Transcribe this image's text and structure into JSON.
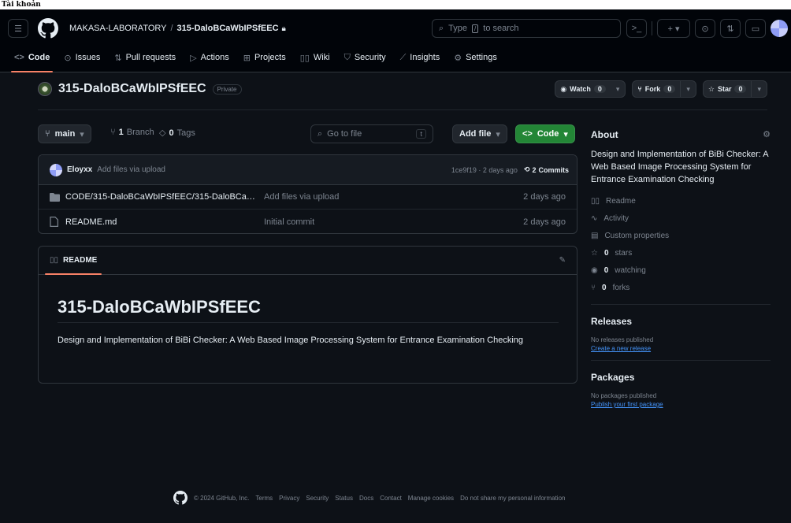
{
  "browser": {
    "tab_label": "Tài khoản"
  },
  "header": {
    "owner": "MAKASA-LABORATORY",
    "separator": "/",
    "repo": "315-DaloBCaWbIPSfEEC",
    "search_placeholder": "Type / to search",
    "search_key": "/"
  },
  "tabs": [
    {
      "label": "Code",
      "icon": "code-icon"
    },
    {
      "label": "Issues",
      "icon": "issue-icon"
    },
    {
      "label": "Pull requests",
      "icon": "pull-request-icon"
    },
    {
      "label": "Actions",
      "icon": "play-icon"
    },
    {
      "label": "Projects",
      "icon": "table-icon"
    },
    {
      "label": "Wiki",
      "icon": "book-icon"
    },
    {
      "label": "Security",
      "icon": "shield-icon"
    },
    {
      "label": "Insights",
      "icon": "graph-icon"
    },
    {
      "label": "Settings",
      "icon": "gear-icon"
    }
  ],
  "repo": {
    "name": "315-DaloBCaWbIPSfEEC",
    "visibility": "Private",
    "watch_label": "Watch",
    "watch_count": "0",
    "fork_label": "Fork",
    "fork_count": "0",
    "star_label": "Star",
    "star_count": "0"
  },
  "branchbar": {
    "branch": "main",
    "branches_count": "1",
    "branches_label": "Branch",
    "tags_count": "0",
    "tags_label": "Tags",
    "goto_placeholder": "Go to file",
    "goto_key": "t",
    "add_file": "Add file",
    "code": "Code"
  },
  "latest_commit": {
    "user": "Eloyxx",
    "message": "Add files via upload",
    "hash_date": "1ce9f19 · 2 days ago",
    "commits_count": "2",
    "commits_label": "Commits"
  },
  "files": [
    {
      "type": "folder",
      "name": "CODE/315-DaloBCaWbIPSfEEC/315-DaloBCaW...",
      "message": "Add files via upload",
      "date": "2 days ago"
    },
    {
      "type": "file",
      "name": "README.md",
      "message": "Initial commit",
      "date": "2 days ago"
    }
  ],
  "readme": {
    "tab_label": "README",
    "heading": "315-DaloBCaWbIPSfEEC",
    "body": "Design and Implementation of BiBi Checker: A Web Based Image Processing System for Entrance Examination Checking"
  },
  "about": {
    "title": "About",
    "description": "Design and Implementation of BiBi Checker: A Web Based Image Processing System for Entrance Examination Checking",
    "readme": "Readme",
    "activity": "Activity",
    "custom_properties": "Custom properties",
    "stars_count": "0",
    "stars_label": "stars",
    "watching_count": "0",
    "watching_label": "watching",
    "forks_count": "0",
    "forks_label": "forks"
  },
  "releases": {
    "title": "Releases",
    "empty": "No releases published",
    "link": "Create a new release"
  },
  "packages": {
    "title": "Packages",
    "empty": "No packages published",
    "link": "Publish your first package"
  },
  "footer": {
    "copyright": "© 2024 GitHub, Inc.",
    "links": [
      "Terms",
      "Privacy",
      "Security",
      "Status",
      "Docs",
      "Contact",
      "Manage cookies",
      "Do not share my personal information"
    ]
  },
  "colors": {
    "background": "#0d1117",
    "accent_tab": "#f78166",
    "primary_button": "#238636",
    "link": "#4493f8"
  }
}
